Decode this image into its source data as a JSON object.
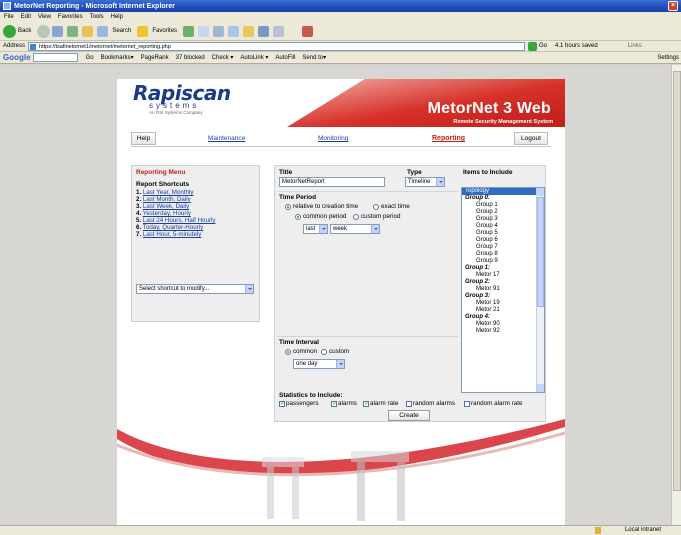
{
  "window": {
    "title": "MetorNet Reporting - Microsoft Internet Explorer"
  },
  "menu": [
    "File",
    "Edit",
    "View",
    "Favorites",
    "Tools",
    "Help"
  ],
  "toolbar": {
    "back_label": "Back",
    "search_label": "Search",
    "favorites_label": "Favorites"
  },
  "address": {
    "label": "Address",
    "url": "https://tsafinetornet1/metornet/metornet_reporting.php",
    "go_label": "Go",
    "saved": "4.1 hours saved",
    "links": "Links"
  },
  "googlebar": {
    "logo": "Google",
    "items": [
      "Go",
      "Bookmarks▾",
      "PageRank",
      "37 blocked",
      "Check ▾",
      "AutoLink ▾",
      "AutoFill",
      "Send to▾"
    ],
    "settings": "Settings"
  },
  "page": {
    "logo_brand": "Rapiscan",
    "logo_systems": "systems",
    "logo_tag": "An OSI Systems Company",
    "product_title": "MetorNet 3 Web",
    "product_subtitle": "Remote Security Management System",
    "nav": {
      "help": "Help",
      "maintenance": "Maintenance",
      "monitoring": "Monitoring",
      "reporting": "Reporting",
      "logout": "Logout"
    },
    "reporting_menu": {
      "heading": "Reporting Menu",
      "shortcuts_heading": "Report Shortcuts",
      "shortcuts": [
        {
          "num": "1.",
          "label": "Last Year, Monthly"
        },
        {
          "num": "2.",
          "label": "Last Month, Daily"
        },
        {
          "num": "3.",
          "label": "Last Week, Daily"
        },
        {
          "num": "4.",
          "label": "Yesterday, Hourly"
        },
        {
          "num": "5.",
          "label": "Last 24 Hours, Half Hourly"
        },
        {
          "num": "6.",
          "label": "Today, Quarter-Hourly"
        },
        {
          "num": "7.",
          "label": "Last Hour, 5-minutely"
        }
      ],
      "shortcut_select": "Select shortcut to modify..."
    },
    "form": {
      "title_label": "Title",
      "title_value": "MetorNetReport",
      "type_label": "Type",
      "type_value": "Timeline",
      "time_period_label": "Time Period",
      "relative_label": "relative to creation time",
      "exact_label": "exact time",
      "common_period_label": "common period",
      "custom_period_label": "custom period",
      "period_qualifier": "last",
      "period_unit": "week",
      "time_interval_label": "Time Interval",
      "common_label": "common",
      "custom_label": "custom",
      "interval_value": "one day",
      "stats_label": "Statistics to Include:",
      "stats": [
        {
          "label": "passengers",
          "checked": true
        },
        {
          "label": "alarms",
          "checked": true
        },
        {
          "label": "alarm rate",
          "checked": true
        },
        {
          "label": "random alarms",
          "checked": false
        },
        {
          "label": "random alarm rate",
          "checked": false
        }
      ],
      "create_label": "Create",
      "items_label": "Items to Include",
      "items": [
        {
          "text": "Topology",
          "kind": "sel"
        },
        {
          "text": "Group 0:",
          "kind": "grp"
        },
        {
          "text": "Group 1",
          "kind": "ind"
        },
        {
          "text": "Group 2",
          "kind": "ind"
        },
        {
          "text": "Group 3",
          "kind": "ind"
        },
        {
          "text": "Group 4",
          "kind": "ind"
        },
        {
          "text": "Group 5",
          "kind": "ind"
        },
        {
          "text": "Group 6",
          "kind": "ind"
        },
        {
          "text": "Group 7",
          "kind": "ind"
        },
        {
          "text": "Group 8",
          "kind": "ind"
        },
        {
          "text": "Group 9",
          "kind": "ind"
        },
        {
          "text": "Group 1:",
          "kind": "grp"
        },
        {
          "text": "Metor 17",
          "kind": "ind"
        },
        {
          "text": "Group 2:",
          "kind": "grp"
        },
        {
          "text": "Metor 91",
          "kind": "ind"
        },
        {
          "text": "Group 3:",
          "kind": "grp"
        },
        {
          "text": "Metor 19",
          "kind": "ind"
        },
        {
          "text": "Metor 21",
          "kind": "ind"
        },
        {
          "text": "Group 4:",
          "kind": "grp"
        },
        {
          "text": "Metor 90",
          "kind": "ind"
        },
        {
          "text": "Metor 92",
          "kind": "ind"
        }
      ]
    }
  },
  "status": {
    "zone": "Local intranet"
  },
  "colors": {
    "brand_red": "#c11f1a",
    "brand_blue": "#1c3a8c",
    "link": "#1a3fa0",
    "selection": "#316ac5"
  }
}
